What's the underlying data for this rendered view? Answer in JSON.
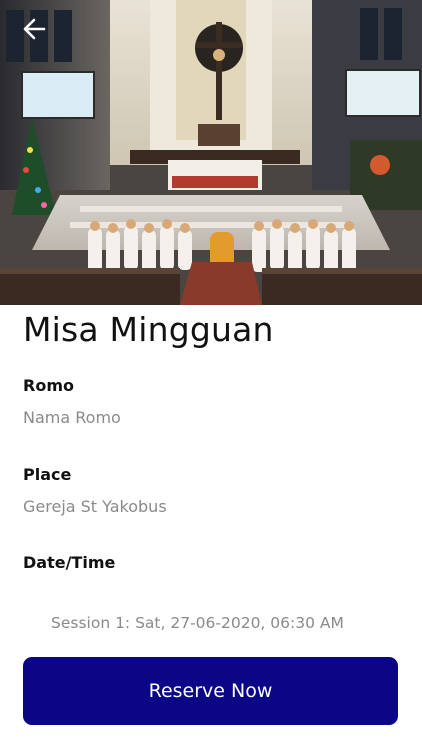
{
  "event": {
    "title": "Misa Mingguan"
  },
  "details": {
    "romo_label": "Romo",
    "romo_value": "Nama Romo",
    "place_label": "Place",
    "place_value": "Gereja St Yakobus",
    "datetime_label": "Date/Time",
    "sessions": [
      "Session 1:  Sat, 27-06-2020, 06:30 AM"
    ]
  },
  "actions": {
    "reserve_label": "Reserve Now"
  },
  "icons": {
    "back": "arrow-left-icon"
  },
  "colors": {
    "primary_button": "#0a0685",
    "label_text": "#111111",
    "value_text": "#8a8a8a"
  }
}
